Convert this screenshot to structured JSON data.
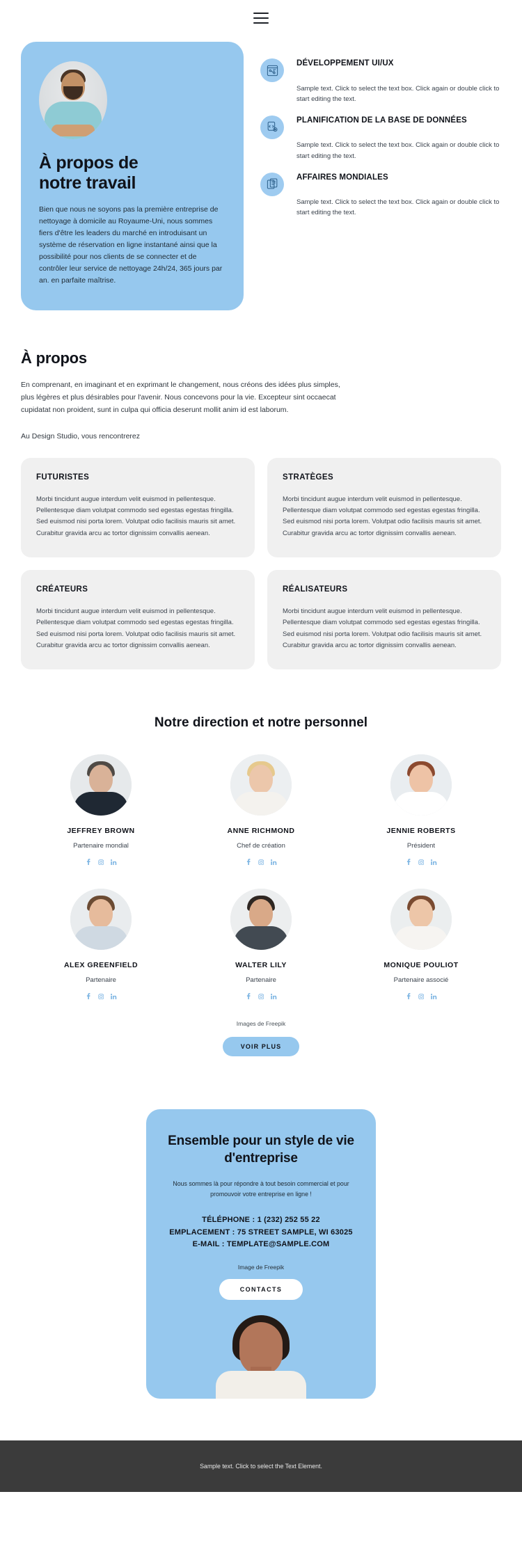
{
  "header": {
    "menu_icon": "hamburger-menu-icon"
  },
  "hero": {
    "title": "À propos de\nnotre travail",
    "title_line1": "À propos de",
    "title_line2": "notre travail",
    "paragraph": "Bien que nous ne soyons pas la première entreprise de nettoyage à domicile au Royaume-Uni, nous sommes fiers d'être les leaders du marché en introduisant un système de réservation en ligne instantané ainsi que la possibilité pour nos clients de se connecter et de contrôler leur service de nettoyage 24h/24, 365 jours par an. en parfaite maîtrise.",
    "avatar_alt": "photo-homme-bras-croises",
    "accent_color": "#96c8ee"
  },
  "services": [
    {
      "icon": "ui-wireframe-icon",
      "title": "DÉVELOPPEMENT UI/UX",
      "text": "Sample text. Click to select the text box. Click again or double click to start editing the text."
    },
    {
      "icon": "database-code-icon",
      "title": "PLANIFICATION DE LA BASE DE DONNÉES",
      "text": "Sample text. Click to select the text box. Click again or double click to start editing the text."
    },
    {
      "icon": "documents-icon",
      "title": "AFFAIRES MONDIALES",
      "text": "Sample text. Click to select the text box. Click again or double click to start editing the text."
    }
  ],
  "about": {
    "heading": "À propos",
    "paragraph": "En comprenant, en imaginant et en exprimant le changement, nous créons des idées plus simples, plus légères et plus désirables pour l'avenir. Nous concevons pour la vie. Excepteur sint occaecat cupidatat non proident, sunt in culpa qui officia deserunt mollit anim id est laborum.",
    "subline": "Au Design Studio, vous rencontrerez"
  },
  "value_cards": [
    {
      "title": "FUTURISTES",
      "text": "Morbi tincidunt augue interdum velit euismod in pellentesque. Pellentesque diam volutpat commodo sed egestas egestas fringilla. Sed euismod nisi porta lorem. Volutpat odio facilisis mauris sit amet. Curabitur gravida arcu ac tortor dignissim convallis aenean."
    },
    {
      "title": "STRATÈGES",
      "text": "Morbi tincidunt augue interdum velit euismod in pellentesque. Pellentesque diam volutpat commodo sed egestas egestas fringilla. Sed euismod nisi porta lorem. Volutpat odio facilisis mauris sit amet. Curabitur gravida arcu ac tortor dignissim convallis aenean."
    },
    {
      "title": "CRÉATEURS",
      "text": "Morbi tincidunt augue interdum velit euismod in pellentesque. Pellentesque diam volutpat commodo sed egestas egestas fringilla. Sed euismod nisi porta lorem. Volutpat odio facilisis mauris sit amet. Curabitur gravida arcu ac tortor dignissim convallis aenean."
    },
    {
      "title": "RÉALISATEURS",
      "text": "Morbi tincidunt augue interdum velit euismod in pellentesque. Pellentesque diam volutpat commodo sed egestas egestas fringilla. Sed euismod nisi porta lorem. Volutpat odio facilisis mauris sit amet. Curabitur gravida arcu ac tortor dignissim convallis aenean."
    }
  ],
  "team": {
    "heading": "Notre direction et notre personnel",
    "credit": "Images de Freepik",
    "more_button": "VOIR PLUS",
    "social_icons": [
      "facebook-icon",
      "instagram-icon",
      "linkedin-icon"
    ],
    "members": [
      {
        "name": "JEFFREY BROWN",
        "role": "Partenaire mondial",
        "skin": "#d9b298",
        "hair": "#4f4a45",
        "body": "#1f2833",
        "bg": "#e6e9eb"
      },
      {
        "name": "ANNE RICHMOND",
        "role": "Chef de création",
        "skin": "#ecc7ab",
        "hair": "#e6c98d",
        "body": "#f4f2ee",
        "bg": "#eceff1"
      },
      {
        "name": "JENNIE ROBERTS",
        "role": "Président",
        "skin": "#eec3a6",
        "hair": "#8c4a2f",
        "body": "#ffffff",
        "bg": "#e9edf0"
      },
      {
        "name": "ALEX GREENFIELD",
        "role": "Partenaire",
        "skin": "#e6bb9c",
        "hair": "#6b4b33",
        "body": "#cfd9e2",
        "bg": "#e9ecee"
      },
      {
        "name": "WALTER LILY",
        "role": "Partenaire",
        "skin": "#d9a988",
        "hair": "#2f2722",
        "body": "#424a52",
        "bg": "#eceeef"
      },
      {
        "name": "MONIQUE POULIOT",
        "role": "Partenaire associé",
        "skin": "#edc6a8",
        "hair": "#7a4b31",
        "body": "#f6f4f1",
        "bg": "#ebeeef"
      }
    ]
  },
  "cta": {
    "heading_line1": "Ensemble pour un style de vie",
    "heading_line2": "d'entreprise",
    "sub_line1": "Nous sommes là pour répondre à tout besoin commercial et pour promouvoir",
    "sub_line2": "votre entreprise en ligne !",
    "phone": "TÉLÉPHONE : 1 (232) 252 55 22",
    "location": "EMPLACEMENT : 75 STREET SAMPLE, WI 63025",
    "email": "E-MAIL : TEMPLATE@SAMPLE.COM",
    "image_credit": "Image de Freepik",
    "button": "CONTACTS",
    "photo_alt": "portrait-femme"
  },
  "footer": {
    "text": "Sample text. Click to select the Text Element."
  }
}
